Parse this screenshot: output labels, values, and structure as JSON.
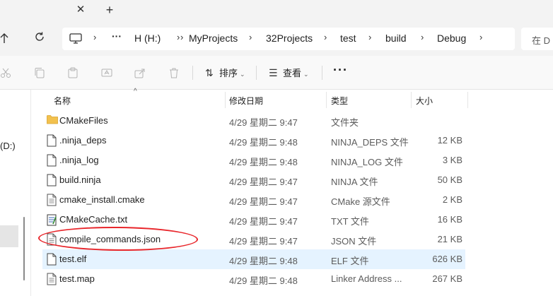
{
  "tabbar": {
    "close_glyph": "✕",
    "new_tab_glyph": "+"
  },
  "address": {
    "breadcrumbs": [
      "H (H:)",
      "MyProjects",
      "32Projects",
      "test",
      "build",
      "Debug"
    ],
    "ellipsis": "···",
    "separator": "›"
  },
  "search": {
    "placeholder": "在 D"
  },
  "commands": {
    "sort_label": "排序",
    "view_label": "查看",
    "more_label": "···",
    "icons": [
      "cut-icon",
      "copy-icon",
      "paste-icon",
      "rename-icon",
      "share-icon",
      "delete-icon"
    ]
  },
  "sidebar": {
    "drive_label": "(D:)"
  },
  "columns": {
    "name": "名称",
    "date": "修改日期",
    "type": "类型",
    "size": "大小"
  },
  "files": [
    {
      "name": "CMakeFiles",
      "date": "4/29 星期二 9:47",
      "type": "文件夹",
      "size": "",
      "icon": "folder-icon"
    },
    {
      "name": ".ninja_deps",
      "date": "4/29 星期二 9:48",
      "type": "NINJA_DEPS 文件",
      "size": "12 KB",
      "icon": "file-icon"
    },
    {
      "name": ".ninja_log",
      "date": "4/29 星期二 9:48",
      "type": "NINJA_LOG 文件",
      "size": "3 KB",
      "icon": "file-icon"
    },
    {
      "name": "build.ninja",
      "date": "4/29 星期二 9:47",
      "type": "NINJA 文件",
      "size": "50 KB",
      "icon": "file-icon"
    },
    {
      "name": "cmake_install.cmake",
      "date": "4/29 星期二 9:47",
      "type": "CMake 源文件",
      "size": "2 KB",
      "icon": "text-file-icon"
    },
    {
      "name": "CMakeCache.txt",
      "date": "4/29 星期二 9:47",
      "type": "TXT 文件",
      "size": "16 KB",
      "icon": "notepad-file-icon"
    },
    {
      "name": "compile_commands.json",
      "date": "4/29 星期二 9:47",
      "type": "JSON 文件",
      "size": "21 KB",
      "icon": "text-file-icon"
    },
    {
      "name": "test.elf",
      "date": "4/29 星期二 9:48",
      "type": "ELF 文件",
      "size": "626 KB",
      "icon": "file-icon"
    },
    {
      "name": "test.map",
      "date": "4/29 星期二 9:48",
      "type": "Linker Address ...",
      "size": "267 KB",
      "icon": "text-file-icon"
    }
  ],
  "selected_index": 7,
  "annotated_index": 6,
  "colors": {
    "selection": "#e5f3ff",
    "annotation": "#e8262b",
    "folder": "#f2c14e"
  }
}
